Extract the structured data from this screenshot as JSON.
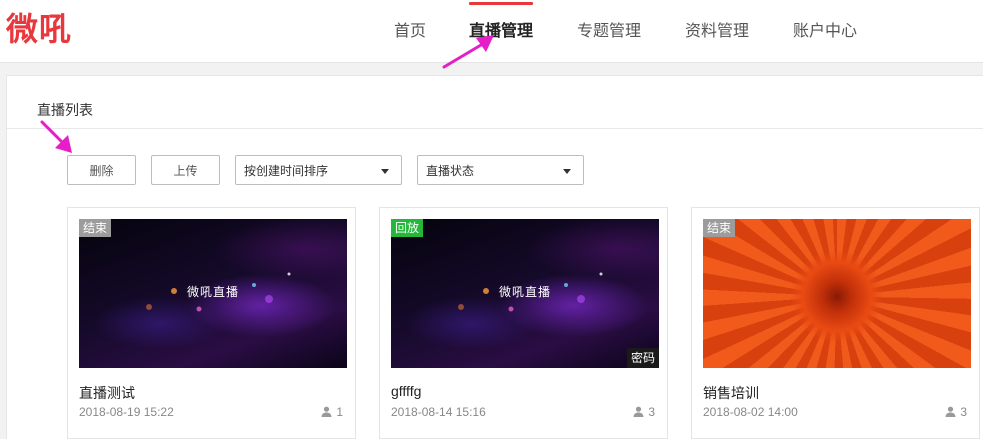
{
  "app": {
    "logo_text": "微吼"
  },
  "nav": {
    "items": [
      {
        "label": "首页"
      },
      {
        "label": "直播管理"
      },
      {
        "label": "专题管理"
      },
      {
        "label": "资料管理"
      },
      {
        "label": "账户中心"
      }
    ],
    "active_index": 1
  },
  "panel": {
    "title": "直播列表",
    "toolbar": {
      "delete_label": "删除",
      "upload_label": "上传",
      "sort_select": {
        "value": "按创建时间排序"
      },
      "status_select": {
        "value": "直播状态"
      }
    }
  },
  "cards": [
    {
      "status": "结束",
      "status_color": "#9c9c9c",
      "thumb_text": "微吼直播",
      "title": "直播测试",
      "date": "2018-08-19 15:22",
      "views": "1",
      "icon": "user-icon"
    },
    {
      "status": "回放",
      "status_color": "#24b83b",
      "thumb_text": "微吼直播",
      "password_badge": "密码",
      "title": "gffffg",
      "date": "2018-08-14 15:16",
      "views": "3",
      "icon": "user-icon"
    },
    {
      "status": "结束",
      "status_color": "#9c9c9c",
      "title": "销售培训",
      "date": "2018-08-02 14:00",
      "views": "3",
      "icon": "user-icon"
    }
  ],
  "colors": {
    "brand": "#e8383d",
    "annotation_arrow": "#e61ec8"
  }
}
